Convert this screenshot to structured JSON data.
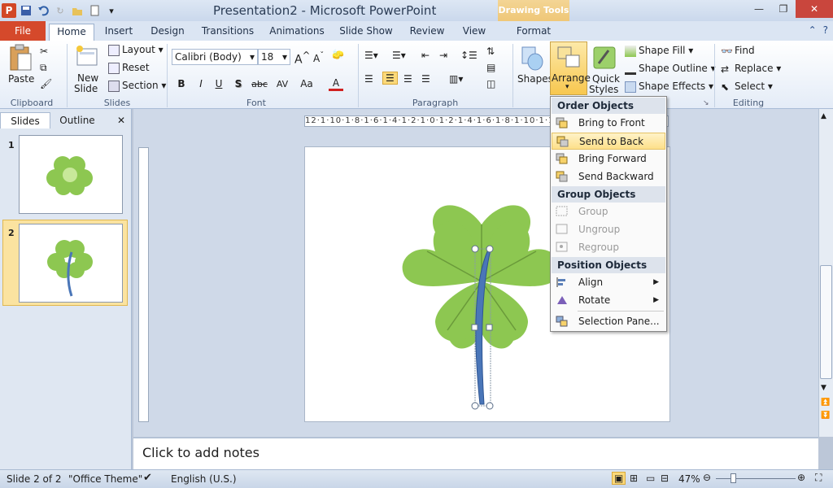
{
  "window": {
    "title": "Presentation2 - Microsoft PowerPoint",
    "context_tab_group": "Drawing Tools"
  },
  "tabs": [
    "File",
    "Home",
    "Insert",
    "Design",
    "Transitions",
    "Animations",
    "Slide Show",
    "Review",
    "View",
    "Format"
  ],
  "ribbon": {
    "clipboard": {
      "paste": "Paste",
      "label": "Clipboard"
    },
    "slides": {
      "new_slide_1": "New",
      "new_slide_2": "Slide",
      "layout": "Layout",
      "reset": "Reset",
      "section": "Section",
      "label": "Slides"
    },
    "font": {
      "font_name": "Calibri (Body)",
      "font_size": "18",
      "label": "Font",
      "bold": "B",
      "italic": "I",
      "underline": "U",
      "shadow": "S",
      "strike": "abc",
      "spacing": "AV",
      "case": "Aa",
      "color": "A"
    },
    "paragraph": {
      "label": "Paragraph"
    },
    "drawing": {
      "shapes": "Shapes",
      "arrange": "Arrange",
      "quick_styles_1": "Quick",
      "quick_styles_2": "Styles",
      "shape_fill": "Shape Fill",
      "shape_outline": "Shape Outline",
      "shape_effects": "Shape Effects"
    },
    "editing": {
      "find": "Find",
      "replace": "Replace",
      "select": "Select",
      "label": "Editing"
    }
  },
  "left_pane": {
    "tabs": [
      "Slides",
      "Outline"
    ],
    "slides": [
      {
        "number": "1"
      },
      {
        "number": "2"
      }
    ]
  },
  "ruler": {
    "horizontal": "12·1·10·1·8·1·6·1·4·1·2·1·0·1·2·1·4·1·6·1·8·1·10·1·12"
  },
  "notes": {
    "placeholder": "Click to add notes"
  },
  "status": {
    "slide": "Slide 2 of 2",
    "theme": "\"Office Theme\"",
    "language": "English (U.S.)",
    "zoom": "47%"
  },
  "arrange_menu": {
    "sections": {
      "order": "Order Objects",
      "group": "Group Objects",
      "position": "Position Objects"
    },
    "order_items": [
      "Bring to Front",
      "Send to Back",
      "Bring Forward",
      "Send Backward"
    ],
    "group_items": [
      "Group",
      "Ungroup",
      "Regroup"
    ],
    "position_items": [
      "Align",
      "Rotate",
      "Selection Pane..."
    ]
  },
  "colors": {
    "clover": "#8dc751",
    "stem": "#4a76b8",
    "file_tab": "#d5492b",
    "highlight": "#fde08a"
  }
}
